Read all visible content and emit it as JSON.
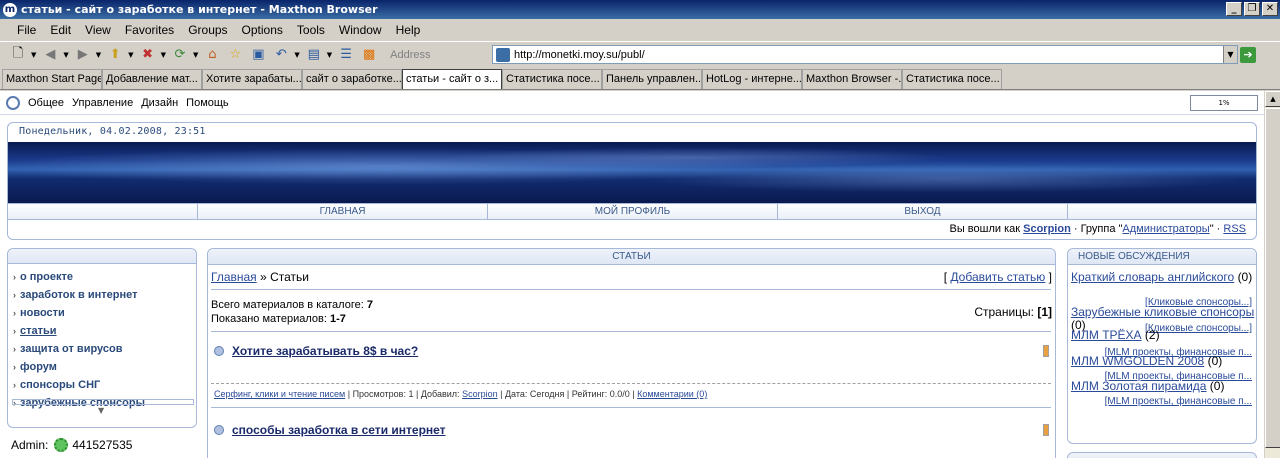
{
  "window": {
    "title": "статьи - сайт о заработке в интернет - Maxthon Browser",
    "app_icon": "m"
  },
  "menu": [
    "File",
    "Edit",
    "View",
    "Favorites",
    "Groups",
    "Options",
    "Tools",
    "Window",
    "Help"
  ],
  "toolbar": {
    "address_label": "Address",
    "url": "http://monetki.moy.su/publ/"
  },
  "tabs": [
    {
      "label": "Maxthon Start Page",
      "active": false
    },
    {
      "label": "Добавление мат...",
      "active": false
    },
    {
      "label": "Хотите зарабаты...",
      "active": false
    },
    {
      "label": "сайт о заработке...",
      "active": false
    },
    {
      "label": "статьи - сайт о з...",
      "active": true
    },
    {
      "label": "Статистика посе...",
      "active": false
    },
    {
      "label": "Панель управлен...",
      "active": false
    },
    {
      "label": "HotLog - интерне...",
      "active": false
    },
    {
      "label": "Maxthon Browser -...",
      "active": false
    },
    {
      "label": "Статистика посе...",
      "active": false
    }
  ],
  "pagebar": {
    "items": [
      "Общее",
      "Управление",
      "Дизайн",
      "Помощь"
    ],
    "progress": "1%"
  },
  "header": {
    "date": "Понедельник, 04.02.2008, 23:51",
    "nav": [
      "ГЛАВНАЯ",
      "МОЙ ПРОФИЛЬ",
      "ВЫХОД"
    ],
    "login_prefix": "Вы вошли как",
    "username": "Scorpion",
    "group_prefix": "· Группа \"",
    "group": "Администраторы",
    "group_suffix": "\" ·",
    "rss": "RSS"
  },
  "left_menu": [
    {
      "label": "о проекте",
      "active": false
    },
    {
      "label": "заработок в интернет",
      "active": false
    },
    {
      "label": "новости",
      "active": false
    },
    {
      "label": "статьи",
      "active": true
    },
    {
      "label": "защита от вирусов",
      "active": false
    },
    {
      "label": "форум",
      "active": false
    },
    {
      "label": "спонсоры СНГ",
      "active": false
    },
    {
      "label": "зарубежные спонсоры",
      "active": false
    }
  ],
  "admin": {
    "label": "Admin:",
    "icq": "441527535"
  },
  "center": {
    "title": "СТАТЬИ",
    "crumb_home": "Главная",
    "crumb_sep": "»",
    "crumb_current": "Статьи",
    "add_open": "[",
    "add_label": "Добавить статью",
    "add_close": "]",
    "total_label": "Всего материалов в каталоге:",
    "total_value": "7",
    "shown_label": "Показано материалов:",
    "shown_value": "1-7",
    "pages_label": "Страницы:",
    "pages_value": "[1]",
    "articles": [
      {
        "title": "Хотите зарабатывать 8$ в час?",
        "category": "Серфинг, клики и чтение писем",
        "views": "Просмотров: 1",
        "added_label": "Добавил:",
        "author": "Scorpion",
        "date": "Дата: Сегодня",
        "rating": "Рейтинг: 0.0/0",
        "comments": "Комментарии (0)"
      },
      {
        "title": "способы заработка в сети интернет"
      }
    ]
  },
  "right": {
    "title": "НОВЫЕ ОБСУЖДЕНИЯ",
    "items": [
      {
        "title": "Краткий словарь английского",
        "count": "(0)",
        "category": "[Кликовые спонсоры...]"
      },
      {
        "title": "Зарубежные кликовые спонсоры",
        "count": "(0)",
        "category": "[Кликовые спонсоры...]"
      },
      {
        "title": "МЛМ ТРЁХА",
        "count": "(2)",
        "category": "[MLM проекты, финансовые п..."
      },
      {
        "title": "МЛМ WMGOLDEN 2008",
        "count": "(0)",
        "category": "[MLM проекты, финансовые п..."
      },
      {
        "title": "МЛМ Золотая пирамида",
        "count": "(0)",
        "category": "[MLM проекты, финансовые п..."
      }
    ]
  }
}
